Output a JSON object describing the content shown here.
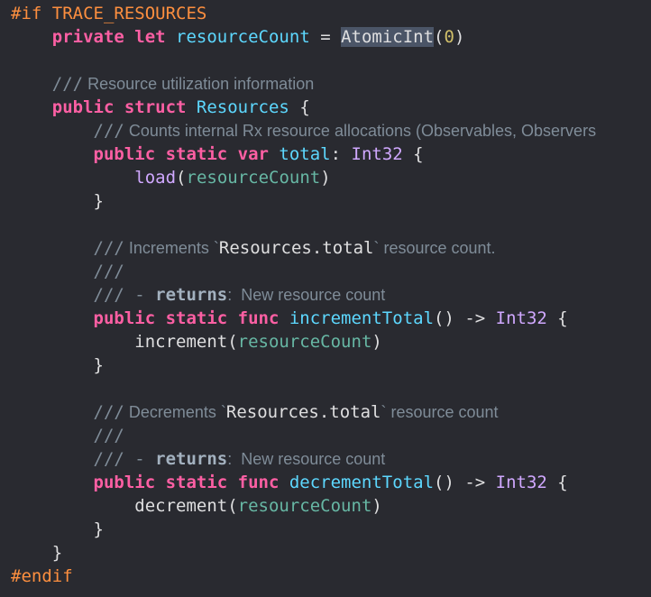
{
  "editor": {
    "theme": {
      "background": "#292a30",
      "selection": "#4b5567"
    },
    "lines": [
      {
        "indent": "",
        "tokens": [
          {
            "t": "dir",
            "v": "#if TRACE_RESOURCES"
          }
        ]
      },
      {
        "indent": "    ",
        "tokens": [
          {
            "t": "kw",
            "v": "private let "
          },
          {
            "t": "decl",
            "v": "resourceCount"
          },
          {
            "t": "plain",
            "v": " = "
          },
          {
            "t": "sel",
            "v": "AtomicInt"
          },
          {
            "t": "plain",
            "v": "("
          },
          {
            "t": "num",
            "v": "0"
          },
          {
            "t": "plain",
            "v": ")"
          }
        ]
      },
      {
        "indent": "",
        "tokens": []
      },
      {
        "indent": "    ",
        "tokens": [
          {
            "t": "cmslash",
            "v": "///"
          },
          {
            "t": "cm",
            "v": " Resource utilization information"
          }
        ]
      },
      {
        "indent": "    ",
        "tokens": [
          {
            "t": "kw",
            "v": "public struct "
          },
          {
            "t": "decl",
            "v": "Resources"
          },
          {
            "t": "plain",
            "v": " {"
          }
        ]
      },
      {
        "indent": "        ",
        "tokens": [
          {
            "t": "cmslash",
            "v": "///"
          },
          {
            "t": "cm",
            "v": " Counts internal Rx resource allocations (Observables, Observers"
          }
        ]
      },
      {
        "indent": "        ",
        "tokens": [
          {
            "t": "kw",
            "v": "public static var "
          },
          {
            "t": "decl",
            "v": "total"
          },
          {
            "t": "plain",
            "v": ": "
          },
          {
            "t": "type",
            "v": "Int32"
          },
          {
            "t": "plain",
            "v": " {"
          }
        ]
      },
      {
        "indent": "            ",
        "tokens": [
          {
            "t": "type",
            "v": "load"
          },
          {
            "t": "plain",
            "v": "("
          },
          {
            "t": "proj",
            "v": "resourceCount"
          },
          {
            "t": "plain",
            "v": ")"
          }
        ]
      },
      {
        "indent": "        ",
        "tokens": [
          {
            "t": "plain",
            "v": "}"
          }
        ]
      },
      {
        "indent": "",
        "tokens": []
      },
      {
        "indent": "        ",
        "tokens": [
          {
            "t": "cmslash",
            "v": "///"
          },
          {
            "t": "cm",
            "v": " Increments `"
          },
          {
            "t": "cmcode",
            "v": "Resources.total"
          },
          {
            "t": "cm",
            "v": "` resource count."
          }
        ]
      },
      {
        "indent": "        ",
        "tokens": [
          {
            "t": "cmslash",
            "v": "///"
          }
        ]
      },
      {
        "indent": "        ",
        "tokens": [
          {
            "t": "cmslash",
            "v": "/// - "
          },
          {
            "t": "cmkw",
            "v": "returns"
          },
          {
            "t": "cm",
            "v": ":  New resource count"
          }
        ]
      },
      {
        "indent": "        ",
        "tokens": [
          {
            "t": "kw",
            "v": "public static func "
          },
          {
            "t": "decl",
            "v": "incrementTotal"
          },
          {
            "t": "plain",
            "v": "() -> "
          },
          {
            "t": "type",
            "v": "Int32"
          },
          {
            "t": "plain",
            "v": " {"
          }
        ]
      },
      {
        "indent": "            ",
        "tokens": [
          {
            "t": "plain",
            "v": "increment("
          },
          {
            "t": "proj",
            "v": "resourceCount"
          },
          {
            "t": "plain",
            "v": ")"
          }
        ]
      },
      {
        "indent": "        ",
        "tokens": [
          {
            "t": "plain",
            "v": "}"
          }
        ]
      },
      {
        "indent": "",
        "tokens": []
      },
      {
        "indent": "        ",
        "tokens": [
          {
            "t": "cmslash",
            "v": "///"
          },
          {
            "t": "cm",
            "v": " Decrements `"
          },
          {
            "t": "cmcode",
            "v": "Resources.total"
          },
          {
            "t": "cm",
            "v": "` resource count"
          }
        ]
      },
      {
        "indent": "        ",
        "tokens": [
          {
            "t": "cmslash",
            "v": "///"
          }
        ]
      },
      {
        "indent": "        ",
        "tokens": [
          {
            "t": "cmslash",
            "v": "/// - "
          },
          {
            "t": "cmkw",
            "v": "returns"
          },
          {
            "t": "cm",
            "v": ":  New resource count"
          }
        ]
      },
      {
        "indent": "        ",
        "tokens": [
          {
            "t": "kw",
            "v": "public static func "
          },
          {
            "t": "decl",
            "v": "decrementTotal"
          },
          {
            "t": "plain",
            "v": "() -> "
          },
          {
            "t": "type",
            "v": "Int32"
          },
          {
            "t": "plain",
            "v": " {"
          }
        ]
      },
      {
        "indent": "            ",
        "tokens": [
          {
            "t": "plain",
            "v": "decrement("
          },
          {
            "t": "proj",
            "v": "resourceCount"
          },
          {
            "t": "plain",
            "v": ")"
          }
        ]
      },
      {
        "indent": "        ",
        "tokens": [
          {
            "t": "plain",
            "v": "}"
          }
        ]
      },
      {
        "indent": "    ",
        "tokens": [
          {
            "t": "plain",
            "v": "}"
          }
        ]
      },
      {
        "indent": "",
        "tokens": [
          {
            "t": "dir",
            "v": "#endif"
          }
        ]
      }
    ]
  }
}
